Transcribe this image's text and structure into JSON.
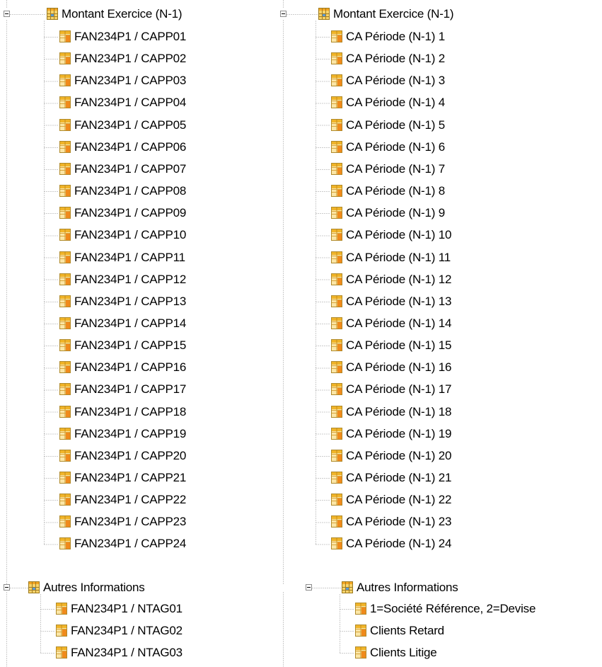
{
  "left_panel": {
    "groups": [
      {
        "label": "Montant Exercice (N-1)",
        "items": [
          "FAN234P1 / CAPP01",
          "FAN234P1 / CAPP02",
          "FAN234P1 / CAPP03",
          "FAN234P1 / CAPP04",
          "FAN234P1 / CAPP05",
          "FAN234P1 / CAPP06",
          "FAN234P1 / CAPP07",
          "FAN234P1 / CAPP08",
          "FAN234P1 / CAPP09",
          "FAN234P1 / CAPP10",
          "FAN234P1 / CAPP11",
          "FAN234P1 / CAPP12",
          "FAN234P1 / CAPP13",
          "FAN234P1 / CAPP14",
          "FAN234P1 / CAPP15",
          "FAN234P1 / CAPP16",
          "FAN234P1 / CAPP17",
          "FAN234P1 / CAPP18",
          "FAN234P1 / CAPP19",
          "FAN234P1 / CAPP20",
          "FAN234P1 / CAPP21",
          "FAN234P1 / CAPP22",
          "FAN234P1 / CAPP23",
          "FAN234P1 / CAPP24"
        ]
      },
      {
        "label": "Autres Informations",
        "items": [
          "FAN234P1 / NTAG01",
          "FAN234P1 / NTAG02",
          "FAN234P1 / NTAG03"
        ]
      }
    ]
  },
  "right_panel": {
    "groups": [
      {
        "label": "Montant Exercice (N-1)",
        "items": [
          "CA Période (N-1) 1",
          "CA Période (N-1) 2",
          "CA Période (N-1) 3",
          "CA Période (N-1) 4",
          "CA Période (N-1) 5",
          "CA Période (N-1) 6",
          "CA Période (N-1) 7",
          "CA Période (N-1) 8",
          "CA Période (N-1) 9",
          "CA Période (N-1) 10",
          "CA Période (N-1) 11",
          "CA Période (N-1) 12",
          "CA Période (N-1) 13",
          "CA Période (N-1) 14",
          "CA Période (N-1) 15",
          "CA Période (N-1) 16",
          "CA Période (N-1) 17",
          "CA Période (N-1) 18",
          "CA Période (N-1) 19",
          "CA Période (N-1) 20",
          "CA Période (N-1) 21",
          "CA Période (N-1) 22",
          "CA Période (N-1) 23",
          "CA Période (N-1) 24"
        ]
      },
      {
        "label": "Autres Informations",
        "items": [
          "1=Société Référence, 2=Devise",
          "Clients Retard",
          "Clients Litige"
        ]
      }
    ]
  },
  "icons": {
    "group": "table-group-icon",
    "field": "table-field-icon",
    "expander": "collapse-minus-icon"
  },
  "colors": {
    "tree_line": "#9a9a9a",
    "icon_gold": "#f0b429",
    "icon_orange": "#f08a1c"
  }
}
